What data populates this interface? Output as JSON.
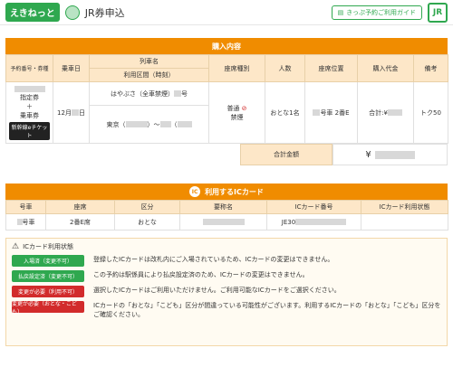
{
  "header": {
    "logo_text": "えきねっと",
    "title": "JR券申込",
    "guide_label": "きっぷ予約ご利用ガイド",
    "jr_label": "JR"
  },
  "purchase": {
    "section_title": "購入内容",
    "columns": [
      "予約番号・券種",
      "乗車日",
      "列車名",
      "座席種別",
      "人数",
      "座席位置",
      "購入代金",
      "備考"
    ],
    "columns_sub": [
      "",
      "",
      "利用区間（時刻）",
      "",
      "",
      "",
      "",
      ""
    ],
    "left_ticket_lines": [
      "指定券",
      "＋",
      "乗車券"
    ],
    "eticket_label": "新幹線eチケット",
    "date": "12月",
    "date_suffix": "日",
    "train_name": "はやぶさ（全車禁煙）",
    "train_suffix": "号",
    "route": "東京（",
    "route_mid": "）〜",
    "route_end": "（",
    "seat_type": "普通",
    "seat_note": "禁煙",
    "people": "おとな1名",
    "seat_pos": "号車 2番E",
    "price_prefix": "合計:¥",
    "note": "トク50",
    "total_label": "合計金額",
    "total_value_prefix": "¥"
  },
  "ic": {
    "section_title": "利用するICカード",
    "icon_label": "IC",
    "columns": [
      "号車",
      "座席",
      "区分",
      "要称名",
      "ICカード番号",
      "ICカード利用状態"
    ],
    "row": [
      "号車",
      "2番E席",
      "おとな",
      "",
      "JE30",
      ""
    ]
  },
  "status": {
    "title": "ICカード利用状態",
    "lines": [
      {
        "btn": "入場済（変更不可）",
        "color": "green",
        "msg": "登録したICカードは改札内にご入場されているため、ICカードの変更はできません。"
      },
      {
        "btn": "払戻設定済（変更不可）",
        "color": "green",
        "msg": "この予約は駅係員により払戻設定済のため、ICカードの変更はできません。"
      },
      {
        "btn": "変更が必要（利用不可）",
        "color": "red",
        "msg": "選択したICカードはご利用いただけません。ご利用可能なICカードをご選択ください。"
      },
      {
        "btn": "変更が必要（おとな・こども）",
        "color": "red",
        "msg": "ICカードの「おとな」「こども」区分が間違っている可能性がございます。利用するICカードの「おとな」「こども」区分をご確認ください。"
      }
    ]
  }
}
